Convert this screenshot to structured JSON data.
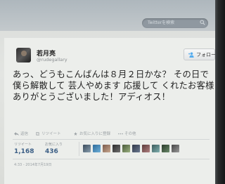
{
  "header": {
    "search_placeholder": "Twitterを検索",
    "search_icon": "search-icon"
  },
  "tweet": {
    "display_name": "若月亮",
    "handle": "@rudegallary",
    "follow_label": "フォロー",
    "text": "あっ、どうもこんばんは８月２日かな？ その日で僕ら解散して 芸人やめます 応援して くれたお客様ありがとうございました！アディオス！",
    "actions": {
      "reply": "返信",
      "retweet": "リツイート",
      "favorite": "お気に入りに登録",
      "more": "その他"
    },
    "stats": {
      "retweets_label": "リツイート",
      "retweets_value": "1,168",
      "favorites_label": "お気に入り",
      "favorites_value": "436"
    },
    "timestamp": "4:33 - 2014年7月19日"
  },
  "colors": {
    "link": "#3c5f86",
    "text": "#1e1e1e",
    "muted": "#9aa0a4"
  }
}
